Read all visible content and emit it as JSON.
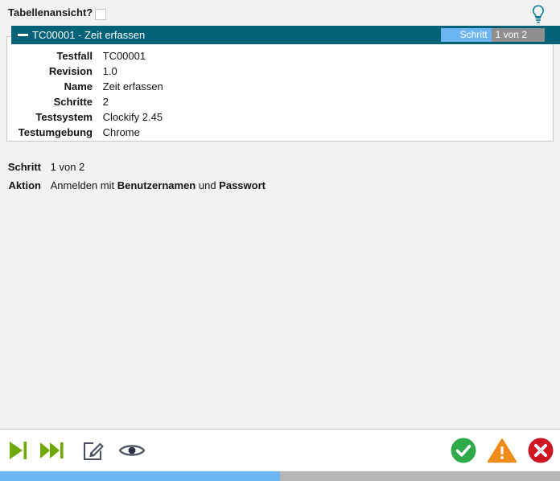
{
  "top_bar": {
    "table_view_label": "Tabellenansicht?",
    "table_view_checked": false,
    "hint_icon": "lightbulb-icon"
  },
  "testcase": {
    "collapse_icon": "minus-collapse-icon",
    "title": "TC00001 - Zeit erfassen",
    "step_badge": {
      "done_label": "Schritt",
      "rest_label": "1 von 2",
      "done_color": "#6db4f2",
      "rest_color": "#8f8f8f"
    },
    "header_color": "#016278",
    "details": [
      {
        "label": "Testfall",
        "value": "TC00001"
      },
      {
        "label": "Revision",
        "value": "1.0"
      },
      {
        "label": "Name",
        "value": "Zeit erfassen"
      },
      {
        "label": "Schritte",
        "value": "2"
      },
      {
        "label": "Testsystem",
        "value": "Clockify 2.45"
      },
      {
        "label": "Testumgebung",
        "value": "Chrome"
      }
    ]
  },
  "current_step": {
    "step_label": "Schritt",
    "step_value": "1 von 2",
    "action_label": "Aktion",
    "action_prefix": "Anmelden mit ",
    "action_term_1": "Benutzernamen",
    "action_middle": " und ",
    "action_term_2": "Passwort"
  },
  "toolbar": {
    "buttons": [
      {
        "name": "step-forward-button",
        "icon": "skip-next-icon",
        "title": "Nächster Schritt",
        "color": "#6fa800"
      },
      {
        "name": "run-to-end-button",
        "icon": "fast-forward-end-icon",
        "title": "Alle Schritte ausführen",
        "color": "#6fa800"
      },
      {
        "name": "edit-button",
        "icon": "edit-pencil-square-icon",
        "title": "Bearbeiten",
        "color": "#4a5160"
      },
      {
        "name": "view-button",
        "icon": "eye-icon",
        "title": "Ansehen",
        "color": "#4a5160"
      },
      {
        "name": "result-pass-button",
        "icon": "check-circle-icon",
        "title": "Bestanden",
        "color": "#2faa4a"
      },
      {
        "name": "result-warn-button",
        "icon": "warning-triangle-icon",
        "title": "Warnung",
        "color": "#f08a1a"
      },
      {
        "name": "result-fail-button",
        "icon": "x-circle-icon",
        "title": "Fehlgeschlagen",
        "color": "#cc1720"
      }
    ]
  },
  "bottom_progress": {
    "percent": 50,
    "fill_color": "#6db4f2",
    "track_color": "#b6b6b6"
  }
}
